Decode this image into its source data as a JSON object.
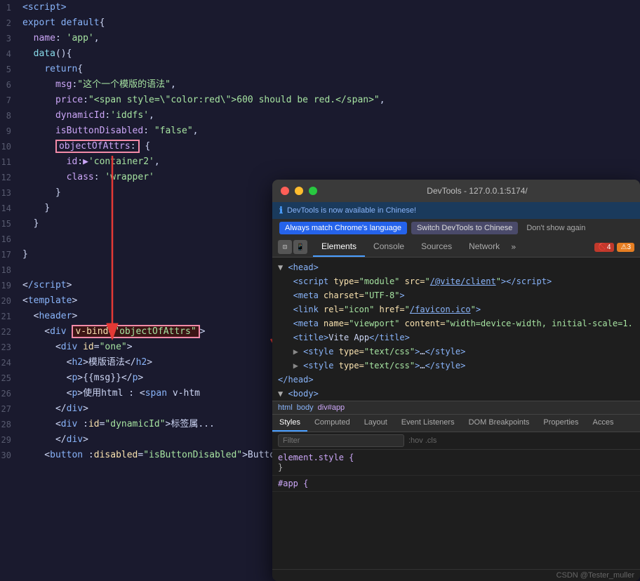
{
  "editor": {
    "lines": [
      {
        "num": "1",
        "html": "<span class='kw'>&lt;script&gt;</span>"
      },
      {
        "num": "2",
        "html": "<span class='kw'>export default</span><span class='tag'>{</span>"
      },
      {
        "num": "3",
        "html": "  <span class='prop'>name</span>: <span class='str'>'app'</span>,"
      },
      {
        "num": "4",
        "html": "  <span class='fn'>data</span>()<span class='tag'>{</span>"
      },
      {
        "num": "5",
        "html": "    <span class='kw'>return</span><span class='tag'>{</span>"
      },
      {
        "num": "6",
        "html": "      <span class='prop'>msg</span>:<span class='str'>\"这个一个模版的语法\"</span>,"
      },
      {
        "num": "7",
        "html": "      <span class='prop'>price</span>:<span class='str'>\"&lt;span style=\\\"color:red\\\"&gt;600 should be red.&lt;/span&gt;\"</span>,"
      },
      {
        "num": "8",
        "html": "      <span class='prop'>dynamicId</span>:<span class='str'>'iddfs'</span>,"
      },
      {
        "num": "9",
        "html": "      <span class='prop'>isButtonDisabled</span>: <span class='str'>\"false\"</span>,"
      },
      {
        "num": "10",
        "html": "      <span style='border:2px solid #f38ba8; padding:0 2px; display:inline-block;'><span class='prop'>objectOfAttrs</span>:</span> <span class='tag'>{</span>"
      },
      {
        "num": "11",
        "html": "        <span class='prop'>id</span>:<span style='color:#cba6f7'>▶</span><span class='str'>'container2'</span>,"
      },
      {
        "num": "12",
        "html": "        <span class='prop'>class</span>: <span class='str'>'wrapper'</span>"
      },
      {
        "num": "13",
        "html": "      <span class='tag'>}</span>"
      },
      {
        "num": "14",
        "html": "    <span class='tag'>}</span>"
      },
      {
        "num": "15",
        "html": "  <span class='tag'>}</span>"
      },
      {
        "num": "16",
        "html": ""
      },
      {
        "num": "17",
        "html": "<span class='tag'>}</span>"
      },
      {
        "num": "18",
        "html": ""
      },
      {
        "num": "19",
        "html": "&lt;<span class='kw'>/script</span>&gt;"
      },
      {
        "num": "20",
        "html": "&lt;<span class='kw'>template</span>&gt;"
      },
      {
        "num": "21",
        "html": "  &lt;<span class='kw'>header</span>&gt;"
      },
      {
        "num": "22",
        "html": "    &lt;<span class='kw'>div</span> <span style='background:#3d1515;border:2px solid #f38ba8;padding:0 2px;'>v-bind=\"objectOfAttrs\"</span>&gt;"
      },
      {
        "num": "23",
        "html": "      &lt;<span class='kw'>div</span> <span class='attr-name'>id</span>=<span class='attr-val'>\"one\"</span>&gt;"
      },
      {
        "num": "24",
        "html": "        &lt;<span class='kw'>h2</span>&gt;模版语法&lt;/<span class='kw'>h2</span>&gt;"
      },
      {
        "num": "25",
        "html": "        &lt;<span class='kw'>p</span>&gt;{{msg}}&lt;/<span class='kw'>p</span>&gt;"
      },
      {
        "num": "26",
        "html": "        &lt;<span class='kw'>p</span>&gt;使用html : &lt;<span class='kw'>span</span> v-htm"
      },
      {
        "num": "27",
        "html": "      &lt;/<span class='kw'>div</span>&gt;"
      },
      {
        "num": "28",
        "html": "      &lt;<span class='kw'>div</span> :<span class='attr-name'>id</span>=<span class='attr-val'>\"dynamicId\"</span>&gt;标签属..."
      },
      {
        "num": "29",
        "html": "      &lt;/<span class='kw'>div</span>&gt;"
      },
      {
        "num": "30",
        "html": "    &lt;<span class='kw'>button</span> :<span class='attr-name'>disabled</span>=<span class='attr-val'>\"isButtonDisabled\"</span>&gt;Button&lt;/<span class='kw'>button</span>&gt;"
      }
    ]
  },
  "devtools": {
    "title": "DevTools - 127.0.0.1:5174/",
    "infobar": "DevTools is now available in Chinese!",
    "lang_btn1": "Always match Chrome's language",
    "lang_btn2": "Switch DevTools to Chinese",
    "lang_btn3": "Don't show again",
    "tabs": [
      "Elements",
      "Console",
      "Sources",
      "Network"
    ],
    "tab_active": "Elements",
    "tab_more": "»",
    "badge_red": "4",
    "badge_orange": "3",
    "breadcrumb": [
      "html",
      "body",
      "div#app"
    ],
    "bottom_tabs": [
      "Styles",
      "Computed",
      "Layout",
      "Event Listeners",
      "DOM Breakpoints",
      "Properties",
      "Acces"
    ],
    "bottom_active": "Styles",
    "filter_placeholder": "Filter",
    "filter_hint": ":hov .cls",
    "styles_rules": [
      {
        "selector": "element.style {",
        "props": []
      },
      {
        "selector": "}",
        "props": []
      },
      {
        "selector": "#app {",
        "props": []
      }
    ],
    "footer_text": "CSDN @Tester_muller"
  }
}
